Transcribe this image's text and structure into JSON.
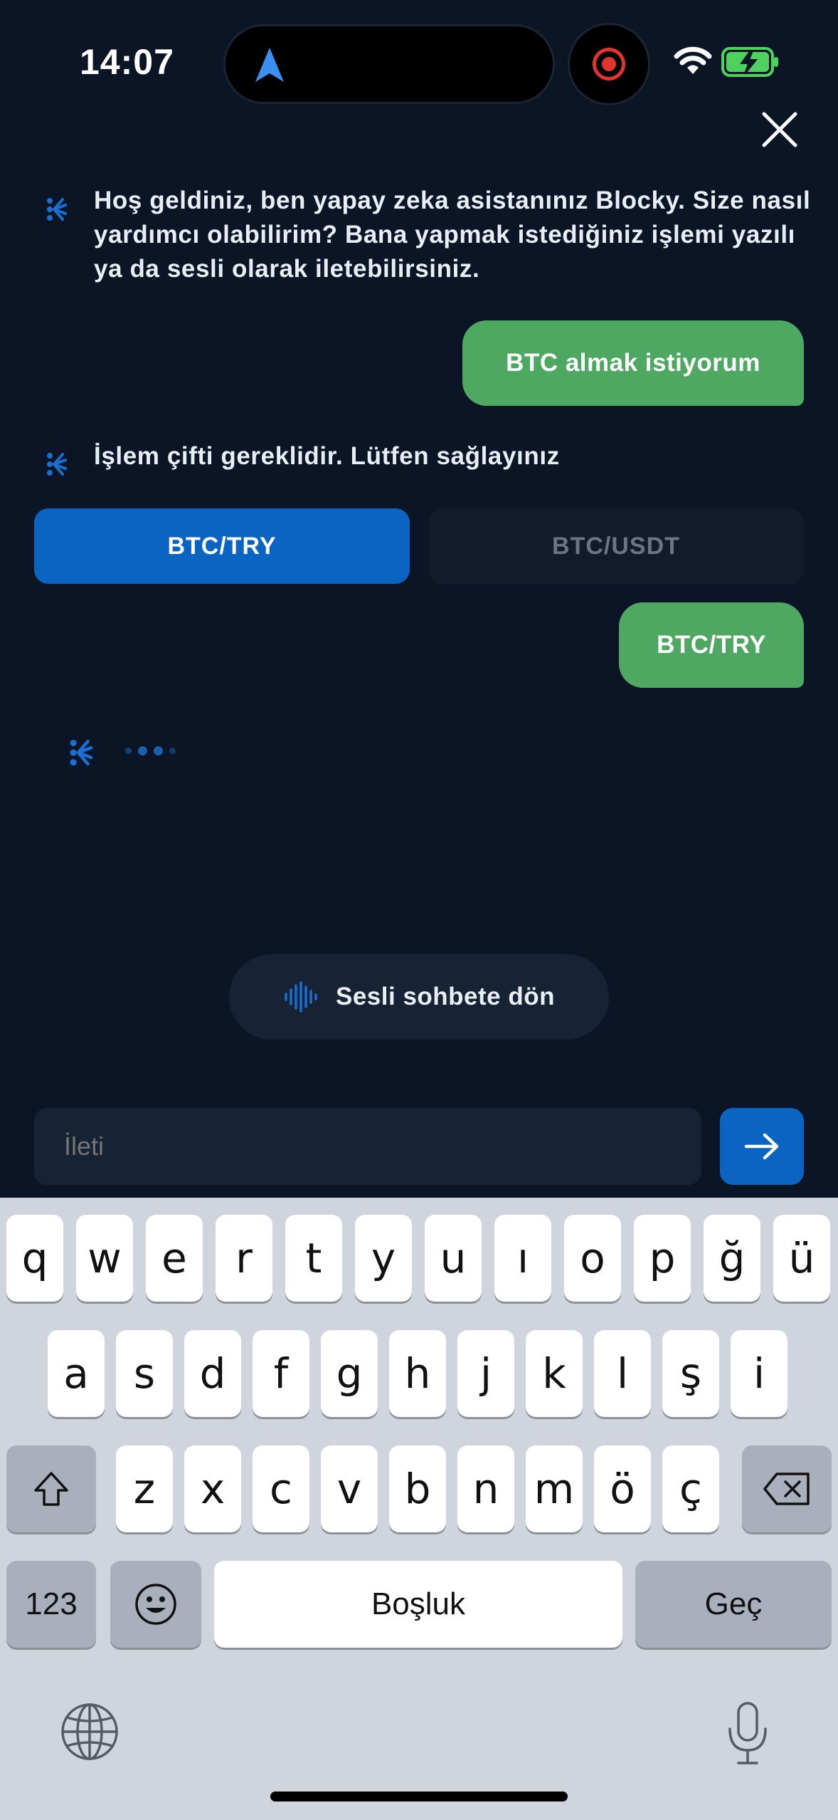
{
  "status_bar": {
    "time": "14:07"
  },
  "chat": {
    "messages": [
      {
        "role": "bot",
        "text": "Hoş geldiniz, ben yapay zeka asistanınız Blocky. Size nasıl yardımcı olabilirim? Bana yapmak istediğiniz işlemi yazılı ya da sesli olarak iletebilirsiniz."
      },
      {
        "role": "user",
        "text": "BTC almak istiyorum"
      },
      {
        "role": "bot",
        "text": "İşlem çifti gereklidir. Lütfen sağlayınız"
      },
      {
        "role": "user",
        "text": "BTC/TRY"
      }
    ],
    "pair_options": [
      "BTC/TRY",
      "BTC/USDT"
    ],
    "selected_pair": "BTC/TRY"
  },
  "voice_button": {
    "label": "Sesli sohbete dön"
  },
  "composer": {
    "placeholder": "İleti"
  },
  "keyboard": {
    "row1": [
      "q",
      "w",
      "e",
      "r",
      "t",
      "y",
      "u",
      "ı",
      "o",
      "p",
      "ğ",
      "ü"
    ],
    "row2": [
      "a",
      "s",
      "d",
      "f",
      "g",
      "h",
      "j",
      "k",
      "l",
      "ş",
      "i"
    ],
    "row3": [
      "z",
      "x",
      "c",
      "v",
      "b",
      "n",
      "m",
      "ö",
      "ç"
    ],
    "numbers_label": "123",
    "space_label": "Boşluk",
    "return_label": "Geç"
  },
  "colors": {
    "background": "#0b1526",
    "accent_blue": "#0a64c2",
    "user_bubble": "#4fa862"
  },
  "icons": [
    "navigation-arrow-icon",
    "record-icon",
    "wifi-icon",
    "battery-charging-icon",
    "close-icon",
    "blocky-bot-icon",
    "voice-wave-icon",
    "send-arrow-icon",
    "shift-icon",
    "backspace-icon",
    "emoji-icon",
    "globe-icon",
    "microphone-icon"
  ]
}
